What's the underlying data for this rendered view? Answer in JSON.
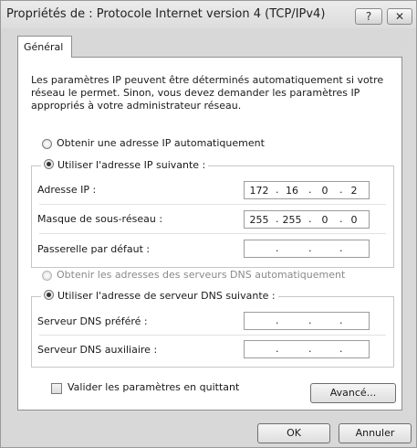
{
  "window": {
    "title": "Propriétés de : Protocole Internet version 4 (TCP/IPv4)",
    "help_glyph": "?",
    "close_glyph": "✕"
  },
  "tab": {
    "label": "Général"
  },
  "intro": "Les paramètres IP peuvent être déterminés automatiquement si votre réseau le permet. Sinon, vous devez demander les paramètres IP appropriés à votre administrateur réseau.",
  "ip_section": {
    "auto_label": "Obtenir une adresse IP automatiquement",
    "manual_label": "Utiliser l'adresse IP suivante :",
    "selected": "manual",
    "fields": [
      {
        "label": "Adresse IP :",
        "octets": [
          "172",
          "16",
          "0",
          "2"
        ]
      },
      {
        "label": "Masque de sous-réseau :",
        "octets": [
          "255",
          "255",
          "0",
          "0"
        ]
      },
      {
        "label": "Passerelle par défaut :",
        "octets": [
          "",
          "",
          "",
          ""
        ]
      }
    ]
  },
  "dns_section": {
    "auto_label": "Obtenir les adresses des serveurs DNS automatiquement",
    "manual_label": "Utiliser l'adresse de serveur DNS suivante :",
    "selected": "manual",
    "fields": [
      {
        "label": "Serveur DNS préféré :",
        "octets": [
          "",
          "",
          "",
          ""
        ]
      },
      {
        "label": "Serveur DNS auxiliaire :",
        "octets": [
          "",
          "",
          "",
          ""
        ]
      }
    ]
  },
  "validate_label": "Valider les paramètres en quittant",
  "validate_checked": false,
  "buttons": {
    "advanced": "Avancé...",
    "ok": "OK",
    "cancel": "Annuler"
  }
}
